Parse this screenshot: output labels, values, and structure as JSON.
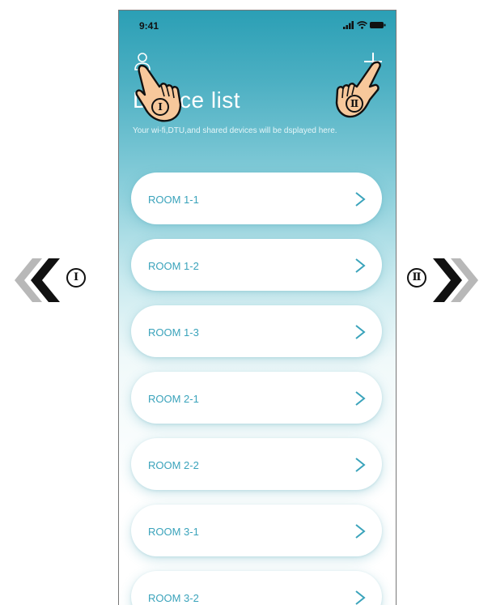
{
  "status_bar": {
    "time": "9:41"
  },
  "header": {
    "title": "Device list",
    "subtitle": "Your wi-fi,DTU,and shared devices will be dsplayed here."
  },
  "annotations": {
    "left_marker": "Ⅰ",
    "right_marker": "Ⅱ",
    "hand_one_marker": "Ⅰ",
    "hand_two_marker": "Ⅱ"
  },
  "devices": [
    {
      "name": "ROOM 1-1"
    },
    {
      "name": "ROOM 1-2"
    },
    {
      "name": "ROOM 1-3"
    },
    {
      "name": "ROOM 2-1"
    },
    {
      "name": "ROOM 2-2"
    },
    {
      "name": "ROOM 3-1"
    },
    {
      "name": "ROOM 3-2"
    }
  ],
  "colors": {
    "accent": "#3aa3bb",
    "header_gradient_top": "#2b9fb5",
    "arrow_dark": "#111111",
    "arrow_light": "#b8b8b8",
    "hand_skin": "#f7c89b"
  },
  "icons": {
    "user": "user-icon",
    "add": "plus-icon",
    "row_chevron": "chevron-right-icon",
    "back": "double-chevron-left-icon",
    "forward": "double-chevron-right-icon"
  }
}
